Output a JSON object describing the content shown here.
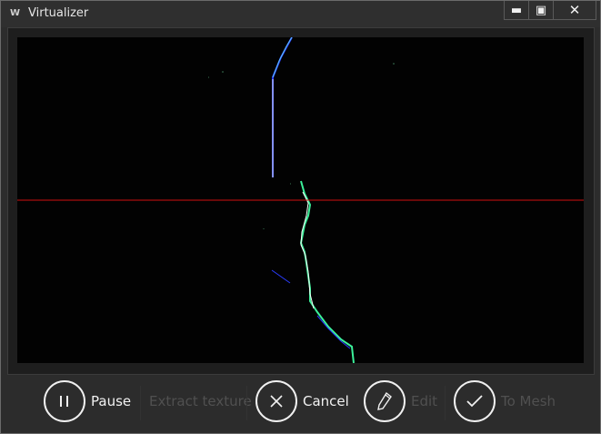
{
  "window": {
    "title": "Virtualizer",
    "app_icon": "W",
    "controls": {
      "minimize": "▬",
      "maximize": "▣",
      "close": "✕"
    }
  },
  "toolbar": {
    "pause_label": "Pause",
    "pause_icon": "pause-icon",
    "extract_texture_label": "Extract texture",
    "cancel_label": "Cancel",
    "cancel_icon": "close-icon",
    "edit_label": "Edit",
    "edit_icon": "pencil-icon",
    "to_mesh_label": "To Mesh",
    "to_mesh_icon": "checkmark-icon"
  },
  "colors": {
    "scanline": "#d01010",
    "profile_blue": "#2a3cff",
    "profile_green": "#3cf09a",
    "disabled_text": "#505050"
  }
}
